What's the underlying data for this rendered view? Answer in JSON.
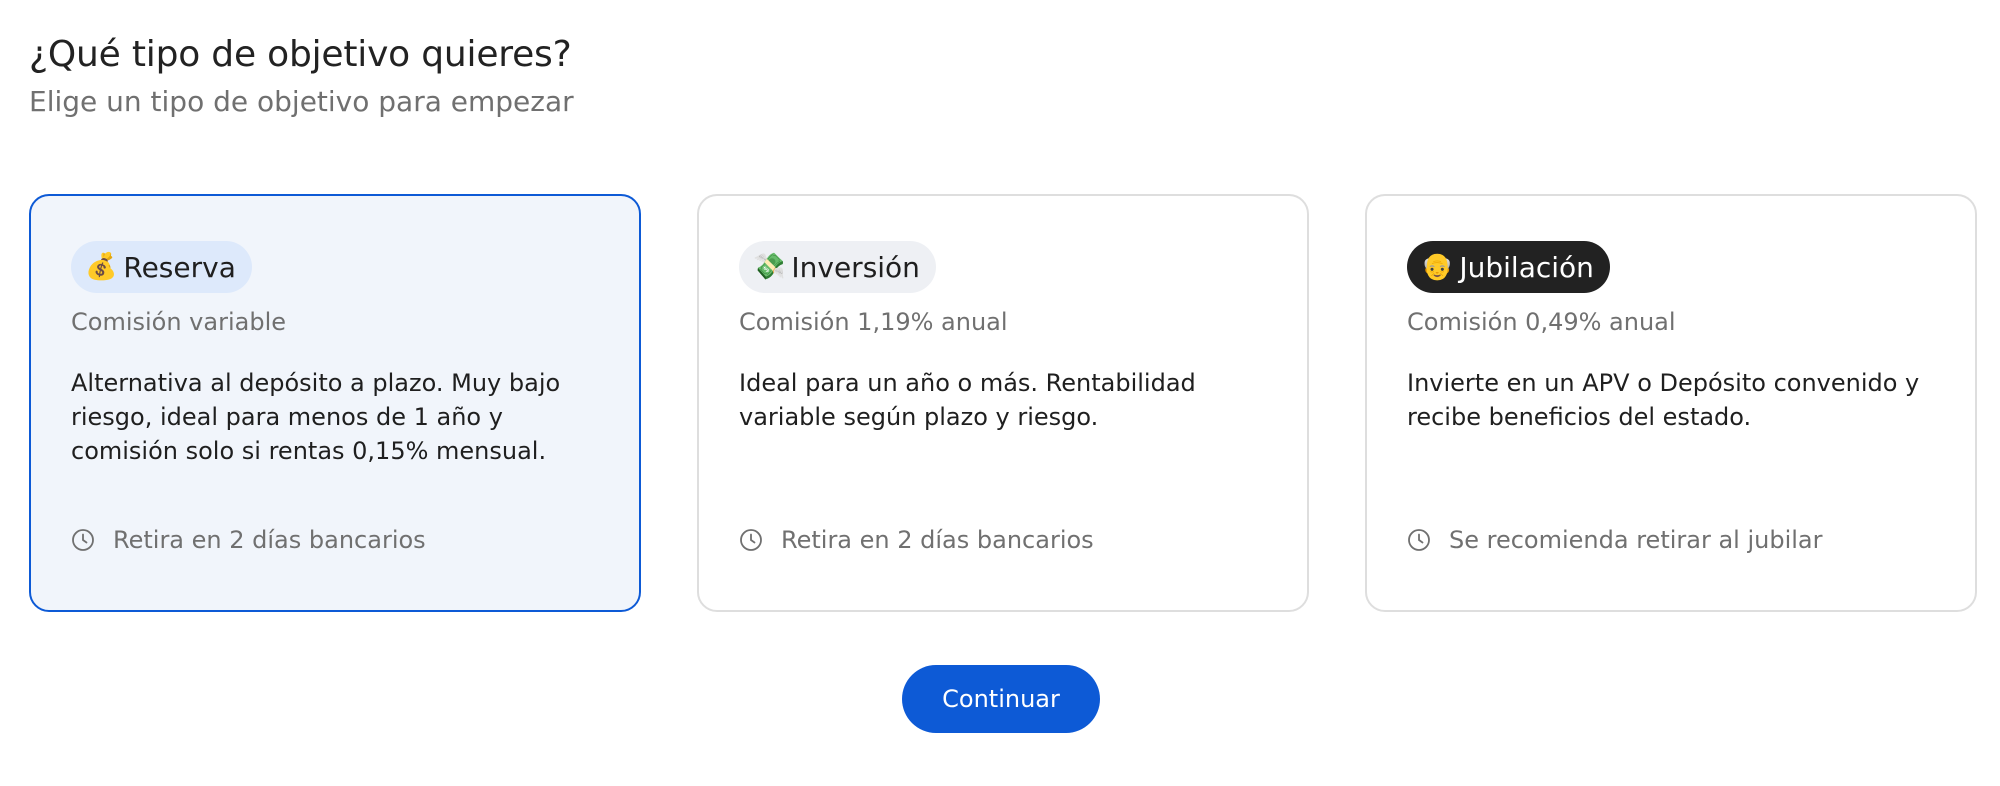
{
  "header": {
    "title": "¿Qué tipo de objetivo quieres?",
    "subtitle": "Elige un tipo de objetivo para empezar"
  },
  "cards": [
    {
      "emoji": "💰",
      "icon": "money-bag-icon",
      "label": "Reserva",
      "commission": "Comisión variable",
      "description": "Alternativa al depósito a plazo. Muy bajo riesgo, ideal para menos de 1 año y comisión solo si rentas 0,15% mensual.",
      "footer": "Retira en 2 días bancarios",
      "selected": true
    },
    {
      "emoji": "💸",
      "icon": "money-with-wings-icon",
      "label": "Inversión",
      "commission": "Comisión 1,19% anual",
      "description": "Ideal para un año o más. Rentabilidad variable según plazo y riesgo.",
      "footer": "Retira en 2 días bancarios",
      "selected": false
    },
    {
      "emoji": "👴",
      "icon": "older-person-icon",
      "label": "Jubilación",
      "commission": "Comisión 0,49% anual",
      "description": "Invierte en un APV o Depósito convenido y recibe beneficios del estado.",
      "footer": "Se recomienda retirar al jubilar",
      "selected": false
    }
  ],
  "actions": {
    "continue_label": "Continuar"
  },
  "colors": {
    "accent": "#0d5ad6",
    "selected_bg": "#f1f5fb",
    "card_border": "#dedede",
    "muted_text": "#707070",
    "dark_badge": "#222222"
  }
}
